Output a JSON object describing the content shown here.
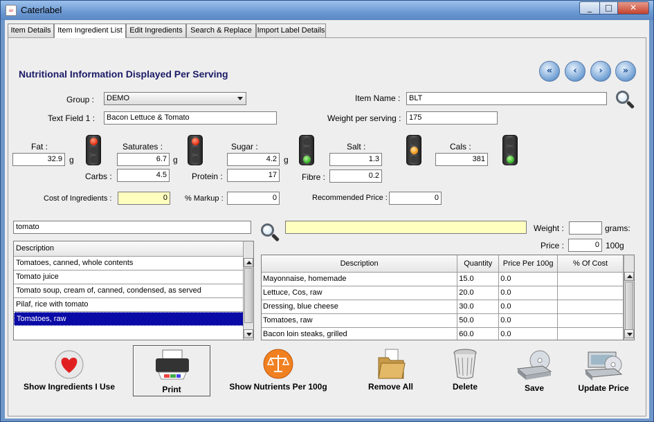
{
  "window": {
    "title": "Caterlabel",
    "min": "_",
    "max": "□",
    "close": "✕"
  },
  "tabs": [
    "Item Details",
    "Item Ingredient List",
    "Edit Ingredients",
    "Search & Replace",
    "Import Label Details"
  ],
  "heading": "Nutritional Information Displayed Per Serving",
  "nav": {
    "first": "«",
    "prev": "‹",
    "next": "›",
    "last": "»"
  },
  "form": {
    "group_label": "Group :",
    "group_value": "DEMO",
    "item_name_label": "Item Name :",
    "item_name_value": "BLT",
    "text_field_label": "Text Field 1 :",
    "text_field_value": "Bacon Lettuce & Tomato",
    "weight_label": "Weight per serving :",
    "weight_value": "175"
  },
  "nutrients": {
    "fat_label": "Fat :",
    "fat_value": "32.9",
    "fat_unit": "g",
    "saturates_label": "Saturates :",
    "saturates_value": "6.7",
    "saturates_unit": "g",
    "sugar_label": "Sugar :",
    "sugar_value": "4.2",
    "sugar_unit": "g",
    "salt_label": "Salt :",
    "salt_value": "1.3",
    "cals_label": "Cals :",
    "cals_value": "381",
    "carbs_label": "Carbs :",
    "carbs_value": "4.5",
    "protein_label": "Protein :",
    "protein_value": "17",
    "fibre_label": "Fibre :",
    "fibre_value": "0.2"
  },
  "traffic_lights": {
    "fat": "red",
    "saturates": "red",
    "sugar": "green",
    "salt": "amber",
    "cals": "green"
  },
  "pricing": {
    "cost_label": "Cost of Ingredients :",
    "cost_value": "0",
    "markup_label": "% Markup :",
    "markup_value": "0",
    "recommended_label": "Recommended Price :",
    "recommended_value": "0"
  },
  "search": {
    "query": "tomato",
    "list_header": "Description",
    "results": [
      "Tomatoes, canned, whole contents",
      "Tomato juice",
      "Tomato soup, cream of, canned, condensed, as served",
      "Pilaf, rice with tomato",
      "Tomatoes, raw"
    ],
    "selected_index": 4
  },
  "selected_ingredient": {
    "name": "",
    "weight_label": "Weight :",
    "weight_value": "",
    "weight_unit": "grams:",
    "price_label": "Price :",
    "price_value": "0",
    "price_unit": "100g"
  },
  "ingredients_table": {
    "columns": [
      "Description",
      "Quantity",
      "Price Per 100g",
      "% Of Cost"
    ],
    "rows": [
      [
        "Mayonnaise, homemade",
        "15.0",
        "0.0",
        ""
      ],
      [
        "Lettuce, Cos, raw",
        "20.0",
        "0.0",
        ""
      ],
      [
        "Dressing, blue cheese",
        "30.0",
        "0.0",
        ""
      ],
      [
        "Tomatoes, raw",
        "50.0",
        "0.0",
        ""
      ],
      [
        "Bacon loin steaks, grilled",
        "60.0",
        "0.0",
        ""
      ]
    ]
  },
  "actions": {
    "show_ingredients": "Show Ingredients I Use",
    "print": "Print",
    "show_nutrients": "Show Nutrients Per 100g",
    "remove_all": "Remove All",
    "delete": "Delete",
    "save": "Save",
    "update_price": "Update Price"
  },
  "colors": {
    "heading": "#1a1a66",
    "highlight_field": "#ffffc0",
    "selection": "#0a0aa6"
  }
}
